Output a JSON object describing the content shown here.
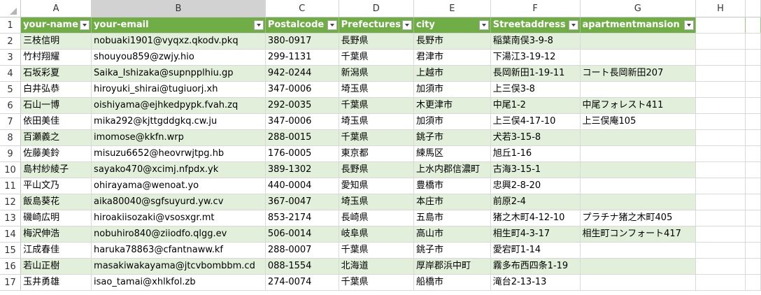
{
  "columns": [
    "A",
    "B",
    "C",
    "D",
    "E",
    "F",
    "G",
    "H"
  ],
  "row_numbers": [
    "1",
    "2",
    "3",
    "4",
    "5",
    "6",
    "7",
    "8",
    "9",
    "10",
    "11",
    "12",
    "13",
    "14",
    "15",
    "16",
    "17"
  ],
  "headers": [
    "your-name",
    "your-email",
    "Postalcode",
    "Prefectures",
    "city",
    "Streetaddress",
    "apartmentmansion"
  ],
  "rows": [
    [
      "三枝信明",
      "nobuaki1901@vyqxz.qkodv.pkq",
      "380-0917",
      "長野県",
      "長野市",
      "稲葉南俣3-9-8",
      ""
    ],
    [
      "竹村翔耀",
      "shouyou859@zwjy.hio",
      "299-1131",
      "千葉県",
      "君津市",
      "下湯江3-19-12",
      ""
    ],
    [
      "石坂彩夏",
      "Saika_Ishizaka@supnpplhiu.gp",
      "942-0244",
      "新潟県",
      "上越市",
      "長岡新田1-19-11",
      "コート長岡新田207"
    ],
    [
      "白井弘恭",
      "hiroyuki_shirai@tugiuorj.xh",
      "347-0006",
      "埼玉県",
      "加須市",
      "上三俣3-8",
      ""
    ],
    [
      "石山一博",
      "oishiyama@ejhkedpypk.fvah.zq",
      "292-0035",
      "千葉県",
      "木更津市",
      "中尾1-2",
      "中尾フォレスト411"
    ],
    [
      "依田美佳",
      "mika292@kjttgddgkq.cw.ju",
      "347-0006",
      "埼玉県",
      "加須市",
      "上三俣4-17-10",
      "上三俣庵105"
    ],
    [
      "百瀬義之",
      "imomose@kkfn.wrp",
      "288-0015",
      "千葉県",
      "銚子市",
      "犬若3-15-8",
      ""
    ],
    [
      "佐藤美鈴",
      "misuzu6652@heovrwjtpg.hb",
      "176-0005",
      "東京都",
      "練馬区",
      "旭丘1-16",
      ""
    ],
    [
      "島村紗綾子",
      "sayako470@xcimj.nfpdx.yk",
      "389-1302",
      "長野県",
      "上水内郡信濃町",
      "古海3-15-1",
      ""
    ],
    [
      "平山文乃",
      "ohirayama@wenoat.yo",
      "440-0004",
      "愛知県",
      "豊橋市",
      "忠興2-8-20",
      ""
    ],
    [
      "飯島葵花",
      "aika80040@sgfsuyurd.yw.cv",
      "367-0047",
      "埼玉県",
      "本庄市",
      "前原2-4",
      ""
    ],
    [
      "磯崎広明",
      "hiroakiisozaki@vsosxgr.mt",
      "853-2174",
      "長崎県",
      "五島市",
      "猪之木町4-12-10",
      "プラチナ猪之木町405"
    ],
    [
      "梅沢伸浩",
      "nobuhiro840@ziiodfo.qlgg.ev",
      "506-0014",
      "岐阜県",
      "高山市",
      "相生町4-3-17",
      "相生町コンフォート417"
    ],
    [
      "江成春佳",
      "haruka78863@cfantnaww.kf",
      "288-0007",
      "千葉県",
      "銚子市",
      "愛宕町1-14",
      ""
    ],
    [
      "若山正樹",
      "masakiwakayama@jtcvbombbm.cd",
      "088-1554",
      "北海道",
      "厚岸郡浜中町",
      "霧多布西四条1-19",
      ""
    ],
    [
      "玉井勇雄",
      "isao_tamai@xhlkfol.zb",
      "274-0074",
      "千葉県",
      "船橋市",
      "滝台2-13-13",
      ""
    ]
  ]
}
